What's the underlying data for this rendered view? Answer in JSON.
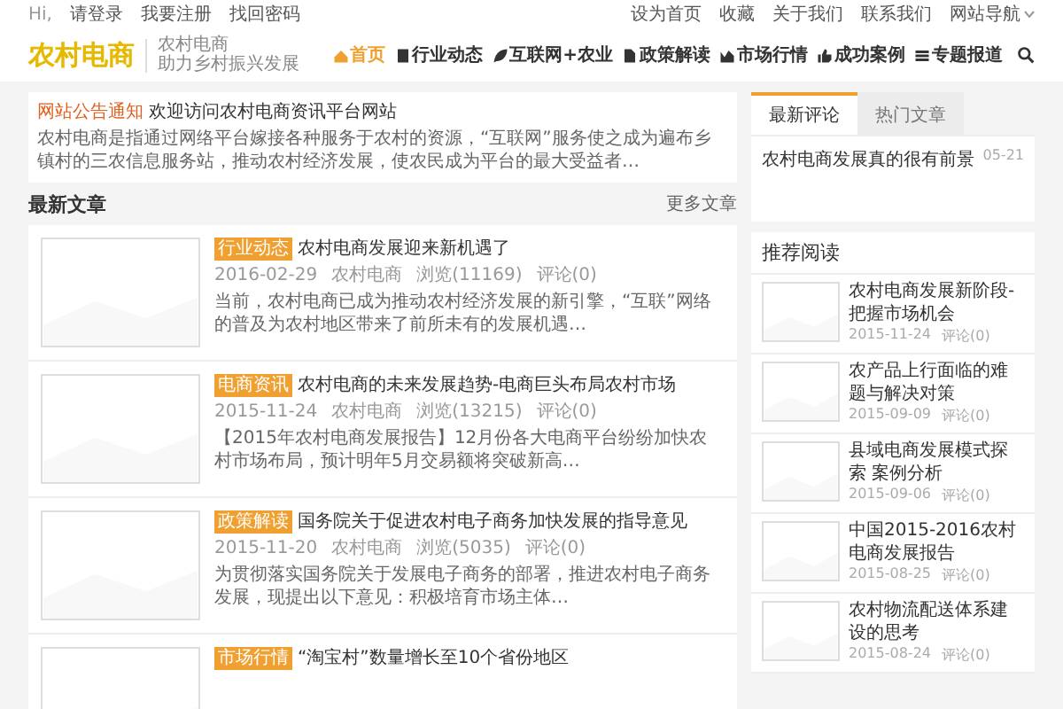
{
  "topbar": {
    "greeting": "Hi,",
    "left_links": [
      "请登录",
      "我要注册",
      "找回密码"
    ],
    "right_links": [
      "设为首页",
      "收藏",
      "关于我们",
      "联系我们"
    ],
    "menu": "网站导航"
  },
  "header": {
    "logo": "农村电商",
    "slogan_1": "农村电商",
    "slogan_2": "助力乡村振兴发展"
  },
  "nav": [
    {
      "label": "首页",
      "selected": true
    },
    {
      "label": "行业动态",
      "selected": false
    },
    {
      "label": "互联网+农业",
      "selected": false
    },
    {
      "label": "政策解读",
      "selected": false
    },
    {
      "label": "市场行情",
      "selected": false
    },
    {
      "label": "成功案例",
      "selected": false
    },
    {
      "label": "专题报道",
      "selected": false
    }
  ],
  "notice": {
    "label": "网站公告通知",
    "title": "欢迎访问农村电商资讯平台网站",
    "text": "农村电商是指通过网络平台嫁接各种服务于农村的资源，“互联网”服务使之成为遍布乡镇村的三农信息服务站，推动农村经济发展，使农民成为平台的最大受益者…"
  },
  "section": {
    "title": "最新文章",
    "more": "更多文章"
  },
  "articles": [
    {
      "tag": "行业动态",
      "title": "农村电商发展迎来新机遇了",
      "date": "2016-02-29",
      "author": "农村电商",
      "views": "浏览(11169)",
      "comments": "评论(0)",
      "excerpt": "当前，农村电商已成为推动农村经济发展的新引擎，“互联”网络的普及为农村地区带来了前所未有的发展机遇…"
    },
    {
      "tag": "电商资讯",
      "title": "农村电商的未来发展趋势-电商巨头布局农村市场",
      "date": "2015-11-24",
      "author": "农村电商",
      "views": "浏览(13215)",
      "comments": "评论(0)",
      "excerpt": "【2015年农村电商发展报告】12月份各大电商平台纷纷加快农村市场布局，预计明年5月交易额将突破新高…"
    },
    {
      "tag": "政策解读",
      "title": "国务院关于促进农村电子商务加快发展的指导意见",
      "date": "2015-11-20",
      "author": "农村电商",
      "views": "浏览(5035)",
      "comments": "评论(0)",
      "excerpt": "为贯彻落实国务院关于发展电子商务的部署，推进农村电子商务发展，现提出以下意见：积极培育市场主体…"
    },
    {
      "tag": "市场行情",
      "title": "“淘宝村”数量增长至10个省份地区"
    }
  ],
  "sidebar": {
    "tabs": [
      {
        "label": "最新评论",
        "selected": true
      },
      {
        "label": "热门文章",
        "selected": false
      }
    ],
    "comment": {
      "text": "农村电商发展真的很有前景",
      "date": "05-21"
    },
    "recommended": {
      "title": "推荐阅读",
      "items": [
        {
          "title": "农村电商发展新阶段-把握市场机会",
          "date": "2015-11-24",
          "comments": "评论(0)"
        },
        {
          "title": "农产品上行面临的难题与解决对策",
          "date": "2015-09-09",
          "comments": "评论(0)"
        },
        {
          "title": "县域电商发展模式探索 案例分析",
          "date": "2015-09-06",
          "comments": "评论(0)"
        },
        {
          "title": "中国2015-2016农村电商发展报告",
          "date": "2015-08-25",
          "comments": "评论(0)"
        },
        {
          "title": "农村物流配送体系建设的思考",
          "date": "2015-08-24",
          "comments": "评论(0)"
        }
      ]
    }
  }
}
